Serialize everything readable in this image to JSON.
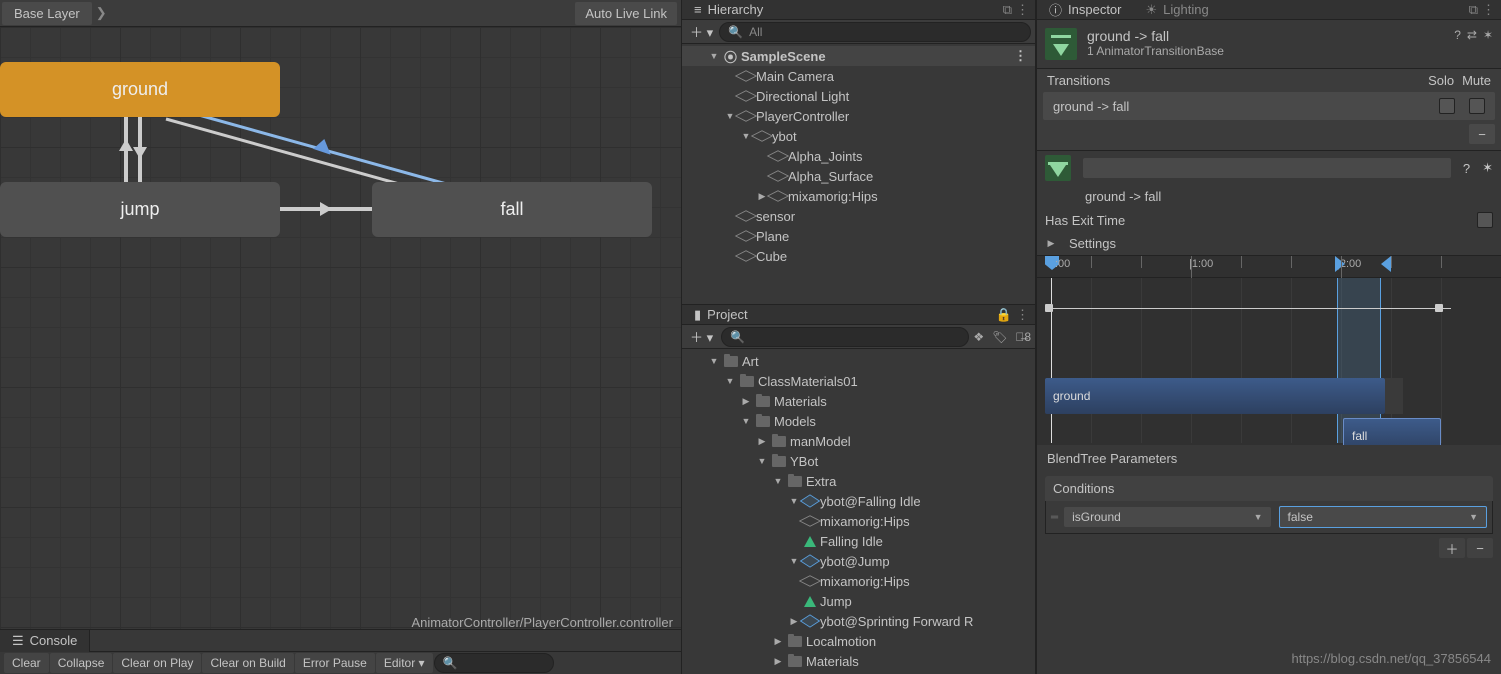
{
  "animator": {
    "breadcrumb": "Base Layer",
    "auto_live_link": "Auto Live Link",
    "states": {
      "ground": "ground",
      "jump": "jump",
      "fall": "fall"
    },
    "path_label": "AnimatorController/PlayerController.controller"
  },
  "console": {
    "tab": "Console",
    "buttons": {
      "clear": "Clear",
      "collapse": "Collapse",
      "clear_on_play": "Clear on Play",
      "clear_on_build": "Clear on Build",
      "error_pause": "Error Pause",
      "editor": "Editor ▾"
    }
  },
  "hierarchy": {
    "tab": "Hierarchy",
    "search_placeholder": "All",
    "scene": "SampleScene",
    "nodes": {
      "main_camera": "Main Camera",
      "directional_light": "Directional Light",
      "player_controller": "PlayerController",
      "ybot": "ybot",
      "alpha_joints": "Alpha_Joints",
      "alpha_surface": "Alpha_Surface",
      "mixamorig_hips": "mixamorig:Hips",
      "sensor": "sensor",
      "plane": "Plane",
      "cube": "Cube"
    }
  },
  "project": {
    "tab": "Project",
    "hidden_count": "8",
    "nodes": {
      "art": "Art",
      "class_materials": "ClassMaterials01",
      "materials": "Materials",
      "models": "Models",
      "man_model": "manModel",
      "ybot_folder": "YBot",
      "extra": "Extra",
      "ybot_falling": "ybot@Falling Idle",
      "mixamorig_hips_a": "mixamorig:Hips",
      "falling_idle": "Falling Idle",
      "ybot_jump": "ybot@Jump",
      "mixamorig_hips_b": "mixamorig:Hips",
      "jump_clip": "Jump",
      "ybot_sprint": "ybot@Sprinting Forward R",
      "localmotion": "Localmotion",
      "materials_2": "Materials"
    }
  },
  "inspector": {
    "tab": "Inspector",
    "lighting_tab": "Lighting",
    "title": "ground -> fall",
    "subtitle": "1 AnimatorTransitionBase",
    "transitions_label": "Transitions",
    "solo": "Solo",
    "mute": "Mute",
    "transition_row": "ground -> fall",
    "transition_name": "ground -> fall",
    "has_exit_time": "Has Exit Time",
    "settings": "Settings",
    "timeline": {
      "t0": ":00",
      "t1": "|1:00",
      "t2": "|2:00",
      "clip_ground": "ground",
      "clip_fall": "fall"
    },
    "blendtree": "BlendTree Parameters",
    "conditions_label": "Conditions",
    "condition_parameter": "isGround",
    "condition_value": "false"
  },
  "watermark": "https://blog.csdn.net/qq_37856544"
}
